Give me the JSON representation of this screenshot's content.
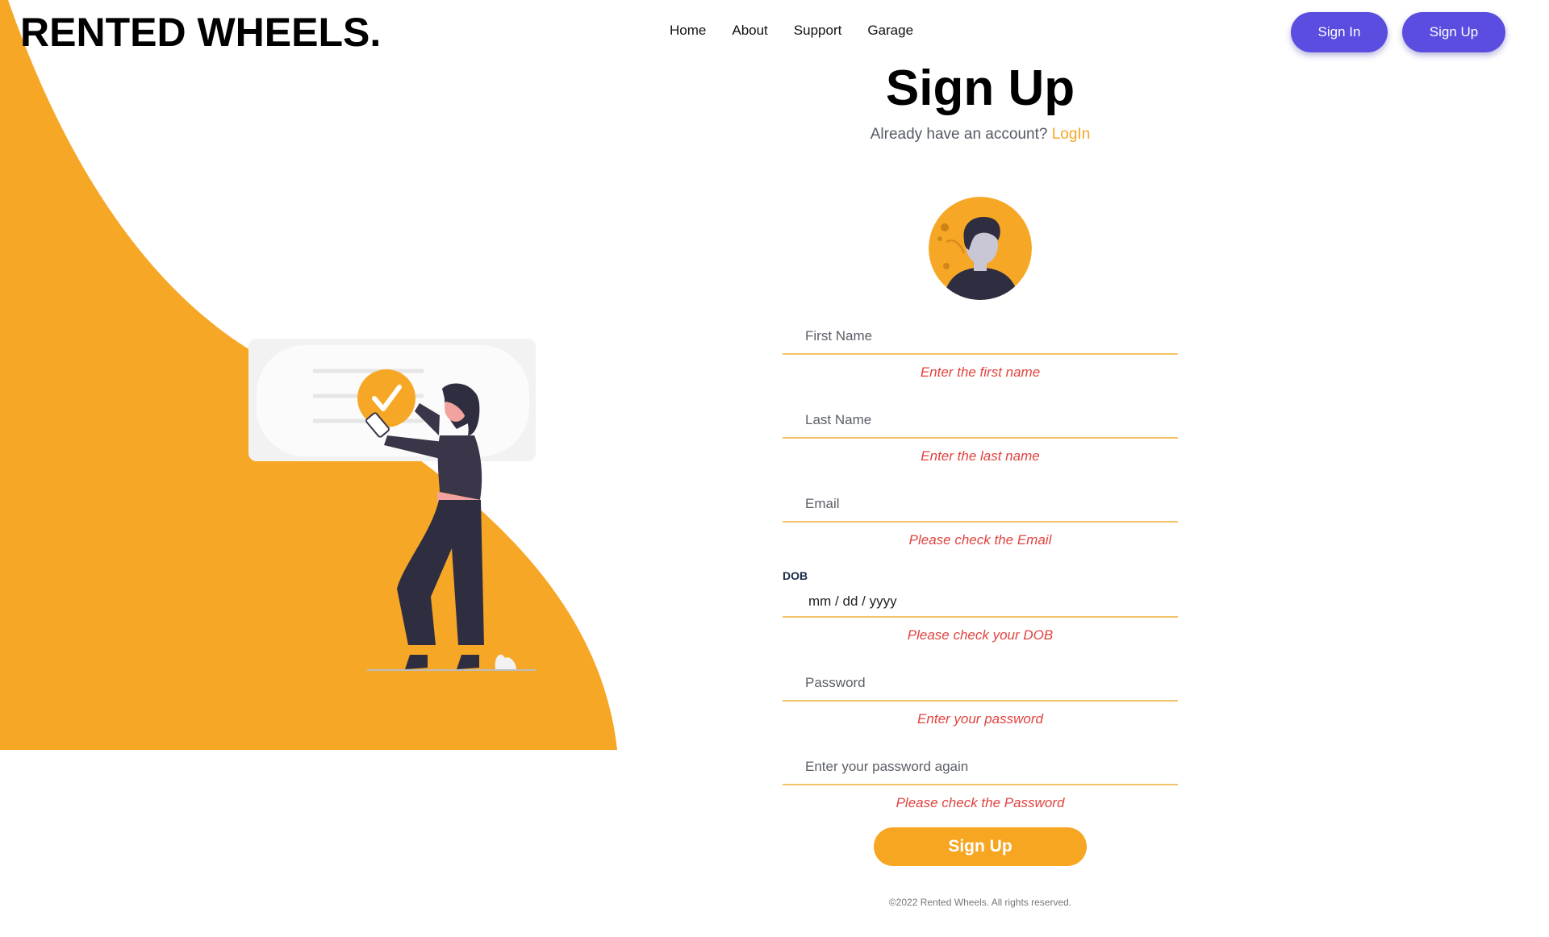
{
  "brand": {
    "logo_text": "RENTED WHEELS."
  },
  "nav": {
    "links": [
      "Home",
      "About",
      "Support",
      "Garage"
    ]
  },
  "auth": {
    "sign_in_label": "Sign In",
    "sign_up_label": "Sign Up"
  },
  "form": {
    "title": "Sign Up",
    "subtitle_prefix": "Already have an account?",
    "login_link": "LogIn",
    "first_name": {
      "placeholder": "First Name",
      "error": "Enter the first name"
    },
    "last_name": {
      "placeholder": "Last Name",
      "error": "Enter the last name"
    },
    "email": {
      "placeholder": "Email",
      "error": "Please check the Email"
    },
    "dob": {
      "label": "DOB",
      "value": "mm / dd / yyyy",
      "error": "Please check your DOB"
    },
    "password": {
      "placeholder": "Password",
      "error": "Enter your password"
    },
    "password_confirm": {
      "placeholder": "Enter your password again",
      "error": "Please check the Password"
    },
    "submit_label": "Sign Up"
  },
  "footer": {
    "text": "©2022 Rented Wheels. All rights reserved."
  },
  "colors": {
    "accent": "#f7a622",
    "primary_button": "#5a4de0",
    "error": "#e0433f",
    "figure_dark": "#3a3548",
    "skin_pink": "#f2a3a0"
  },
  "icons": {
    "avatar": "user-avatar-icon",
    "check": "checkmark-icon"
  }
}
